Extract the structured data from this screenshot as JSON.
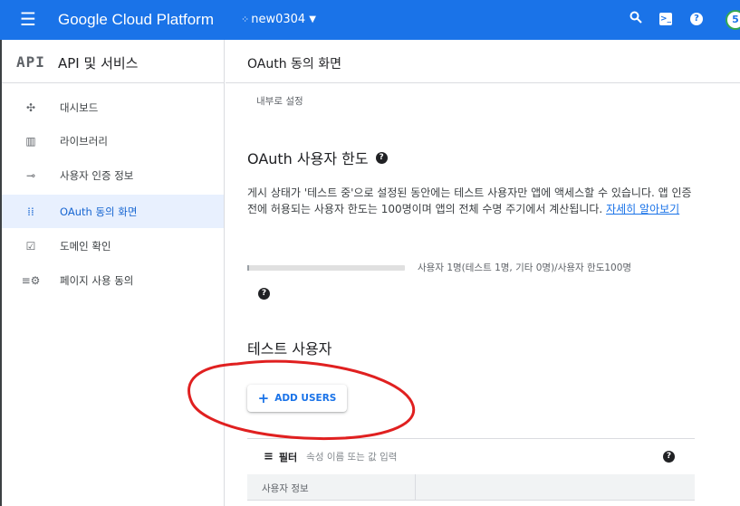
{
  "topbar": {
    "app_name": "Google Cloud Platform",
    "project_name": "new0304",
    "project_icon": "dots-icon",
    "avatar_initial": "5"
  },
  "sidebar": {
    "api_badge": "API",
    "title": "API 및 서비스",
    "items": [
      {
        "label": "대시보드",
        "icon": "dashboard-icon"
      },
      {
        "label": "라이브러리",
        "icon": "library-icon"
      },
      {
        "label": "사용자 인증 정보",
        "icon": "key-icon"
      },
      {
        "label": "OAuth 동의 화면",
        "icon": "consent-icon",
        "active": true
      },
      {
        "label": "도메인 확인",
        "icon": "checkbox-icon"
      },
      {
        "label": "페이지 사용 동의",
        "icon": "settings-list-icon"
      }
    ]
  },
  "main": {
    "page_title": "OAuth 동의 화면",
    "sub_label": "내부로 설정",
    "quota_heading": "OAuth 사용자 한도",
    "quota_desc": "게시 상태가 '테스트 중'으로 설정된 동안에는 테스트 사용자만 앱에 액세스할 수 있습니다. 앱 인증 전에 허용되는 사용자 한도는 100명이며 앱의 전체 수명 주기에서 계산됩니다.",
    "learn_more": "자세히 알아보기",
    "quota_fraction": 0.01,
    "quota_text": "사용자 1명(테스트 1명, 기타 0명)/사용자 한도100명",
    "test_users_heading": "테스트 사용자",
    "add_users_label": "ADD USERS",
    "filter_label": "필터",
    "filter_placeholder": "속성 이름 또는 값 입력",
    "table_header": "사용자 정보"
  },
  "colors": {
    "brand": "#1a73e8",
    "active_bg": "#e8f0fe",
    "annotation": "#e02020"
  }
}
